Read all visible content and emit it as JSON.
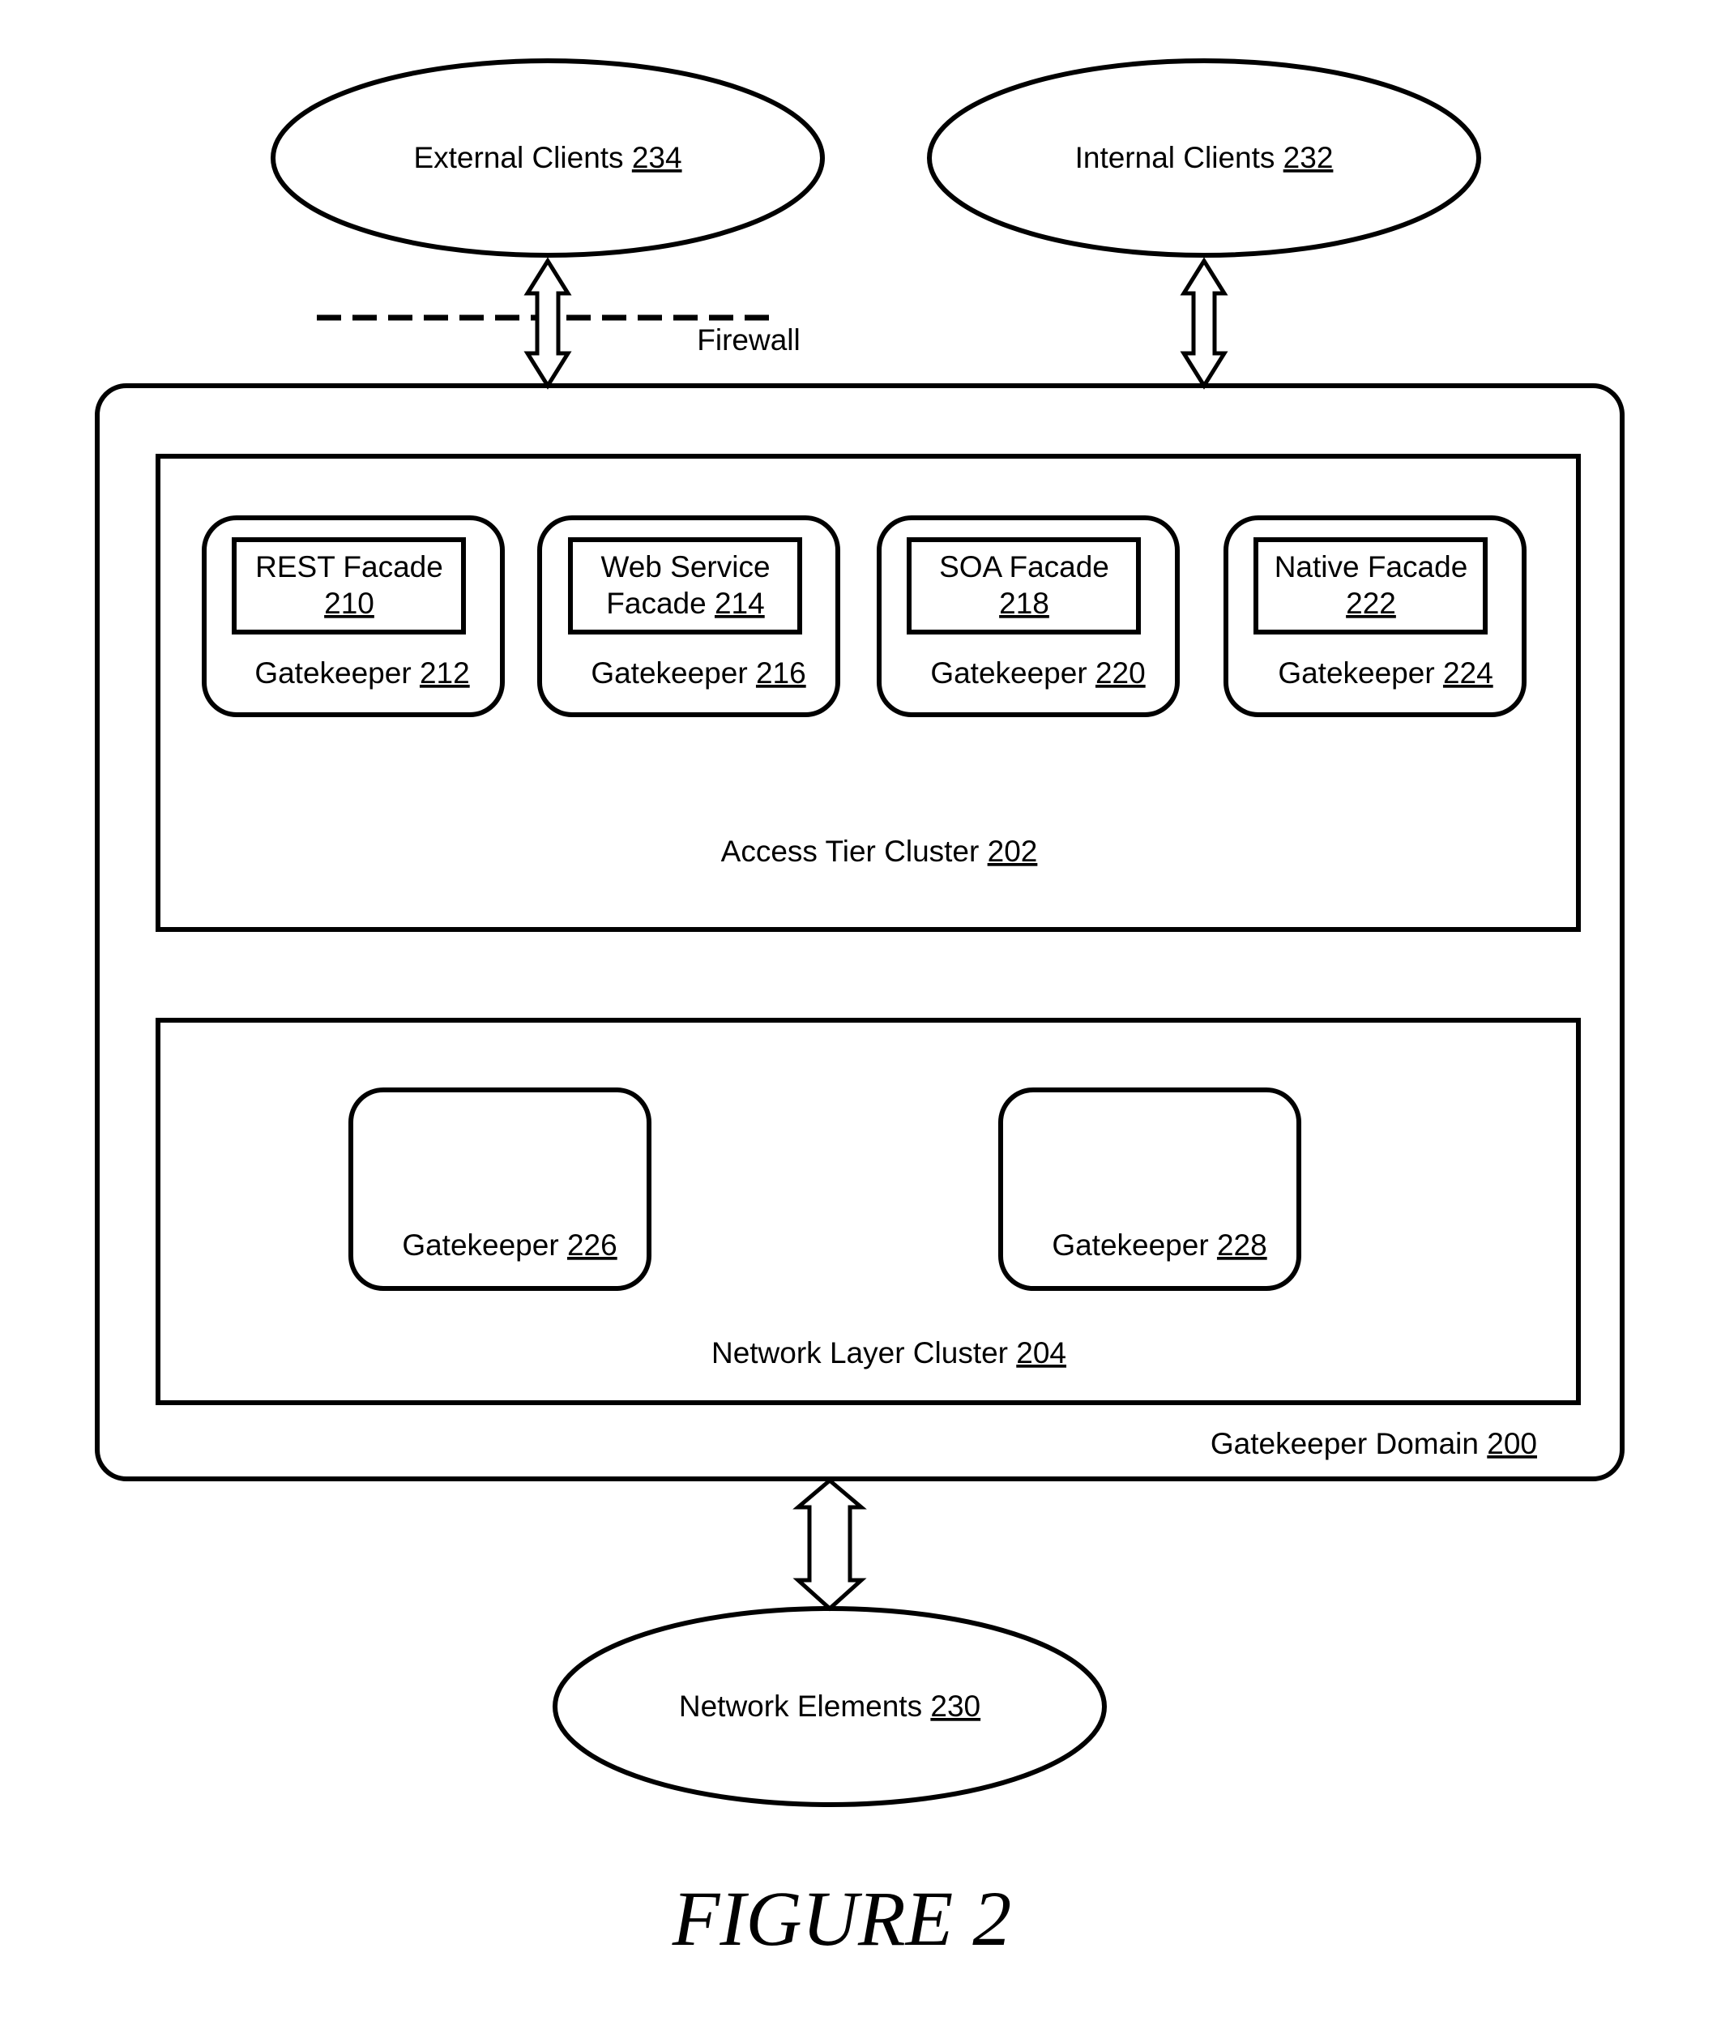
{
  "external_clients": {
    "label": "External Clients",
    "ref": "234"
  },
  "internal_clients": {
    "label": "Internal Clients",
    "ref": "232"
  },
  "firewall": {
    "label": "Firewall"
  },
  "gatekeeper_domain": {
    "label": "Gatekeeper Domain",
    "ref": "200"
  },
  "access_tier_cluster": {
    "label": "Access Tier Cluster",
    "ref": "202",
    "gatekeepers": [
      {
        "facade_line1": "REST Facade",
        "facade_line2": "",
        "facade_ref": "210",
        "label": "Gatekeeper",
        "ref": "212"
      },
      {
        "facade_line1": "Web Service",
        "facade_line2": "Facade",
        "facade_ref": "214",
        "label": "Gatekeeper",
        "ref": "216"
      },
      {
        "facade_line1": "SOA Facade",
        "facade_line2": "",
        "facade_ref": "218",
        "label": "Gatekeeper",
        "ref": "220"
      },
      {
        "facade_line1": "Native Facade",
        "facade_line2": "",
        "facade_ref": "222",
        "label": "Gatekeeper",
        "ref": "224"
      }
    ]
  },
  "network_layer_cluster": {
    "label": "Network Layer Cluster",
    "ref": "204",
    "gatekeepers": [
      {
        "label": "Gatekeeper",
        "ref": "226"
      },
      {
        "label": "Gatekeeper",
        "ref": "228"
      }
    ]
  },
  "network_elements": {
    "label": "Network Elements",
    "ref": "230"
  },
  "caption": "FIGURE 2"
}
